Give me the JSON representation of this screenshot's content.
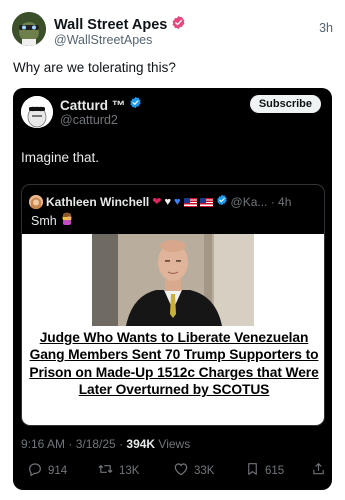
{
  "post": {
    "author_name": "Wall Street Apes",
    "author_handle": "@WallStreetApes",
    "time": "3h",
    "text": "Why are we tolerating this?"
  },
  "embedded": {
    "author_name": "Catturd ™",
    "author_handle": "@catturd2",
    "subscribe_label": "Subscribe",
    "text": "Imagine that.",
    "quote": {
      "author_name": "Kathleen Winchell",
      "handle_time": "@Ka... · 4h",
      "text": "Smh",
      "headline": "Judge Who Wants to Liberate Venezuelan Gang Members Sent 70 Trump Supporters to Prison on Made-Up 1512c Charges that Were Later Overturned by SCOTUS"
    },
    "timestamp": "9:16 AM · 3/18/25 · ",
    "views_count": "394K",
    "views_label": " Views",
    "actions": {
      "replies": "914",
      "reposts": "13K",
      "likes": "33K",
      "bookmarks": "615"
    }
  },
  "colors": {
    "verified_pink": "#e8467c",
    "verified_blue": "#1d9bf0",
    "card_bg": "#000000"
  },
  "icons": [
    "verified-badge-icon",
    "reply-icon",
    "repost-icon",
    "like-icon",
    "bookmark-icon",
    "share-icon"
  ]
}
